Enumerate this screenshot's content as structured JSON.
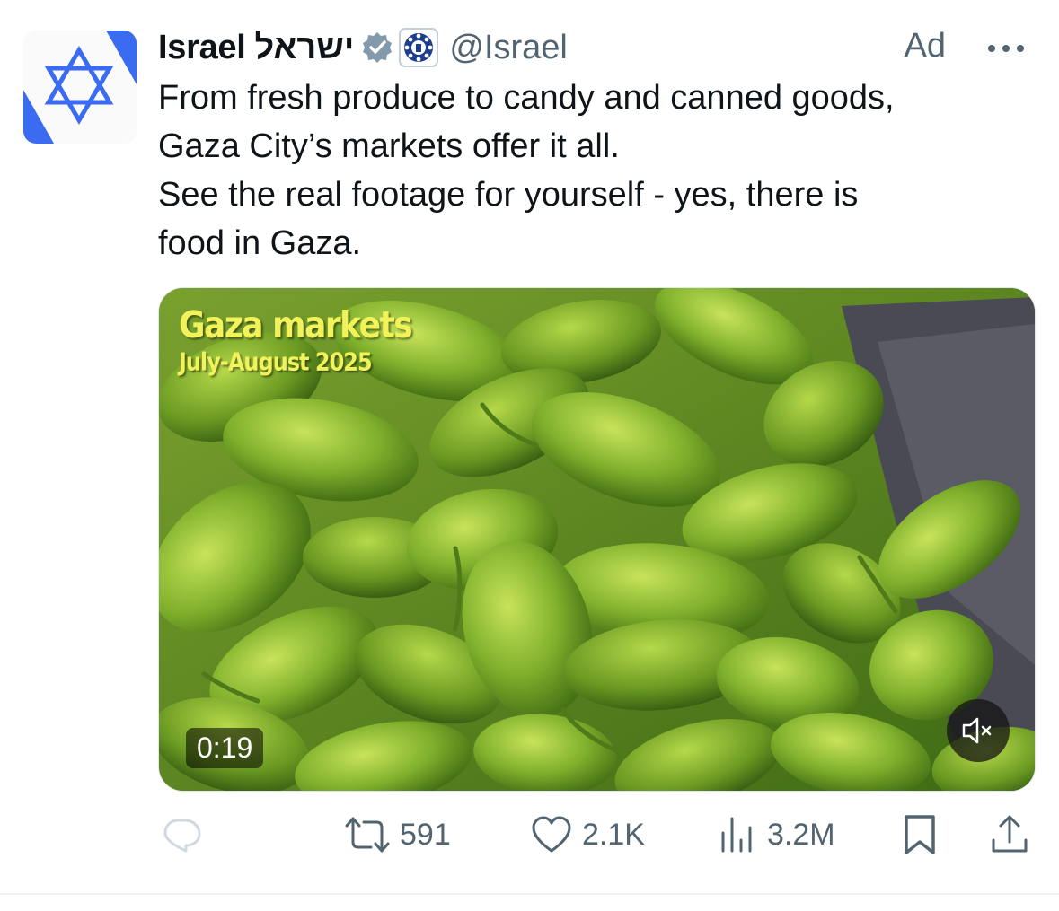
{
  "author": {
    "display_name": "Israel",
    "display_name_hebrew": "ישראל",
    "handle": "@Israel"
  },
  "ad_label": "Ad",
  "tweet": {
    "lines": [
      "From fresh produce to candy and canned goods,",
      "Gaza City’s markets offer it all.",
      "See the real footage for yourself - yes, there is",
      "food in Gaza."
    ]
  },
  "video": {
    "overlay_title": "Gaza markets",
    "overlay_subtitle": "July-August 2025",
    "duration": "0:19"
  },
  "actions": {
    "retweets": "591",
    "likes": "2.1K",
    "views": "3.2M"
  },
  "icons": {
    "verified": "verified-badge-icon",
    "government": "government-affiliation-icon",
    "more": "more-options-icon",
    "reply": "reply-icon",
    "retweet": "retweet-icon",
    "like": "heart-icon",
    "views": "views-icon",
    "bookmark": "bookmark-icon",
    "share": "share-icon",
    "mute": "muted-speaker-icon"
  },
  "colors": {
    "brand_blue": "#3a6bf0",
    "verified_gray": "#829aab",
    "secondary_text": "#536471",
    "overlay_yellow": "#f2f35a"
  }
}
